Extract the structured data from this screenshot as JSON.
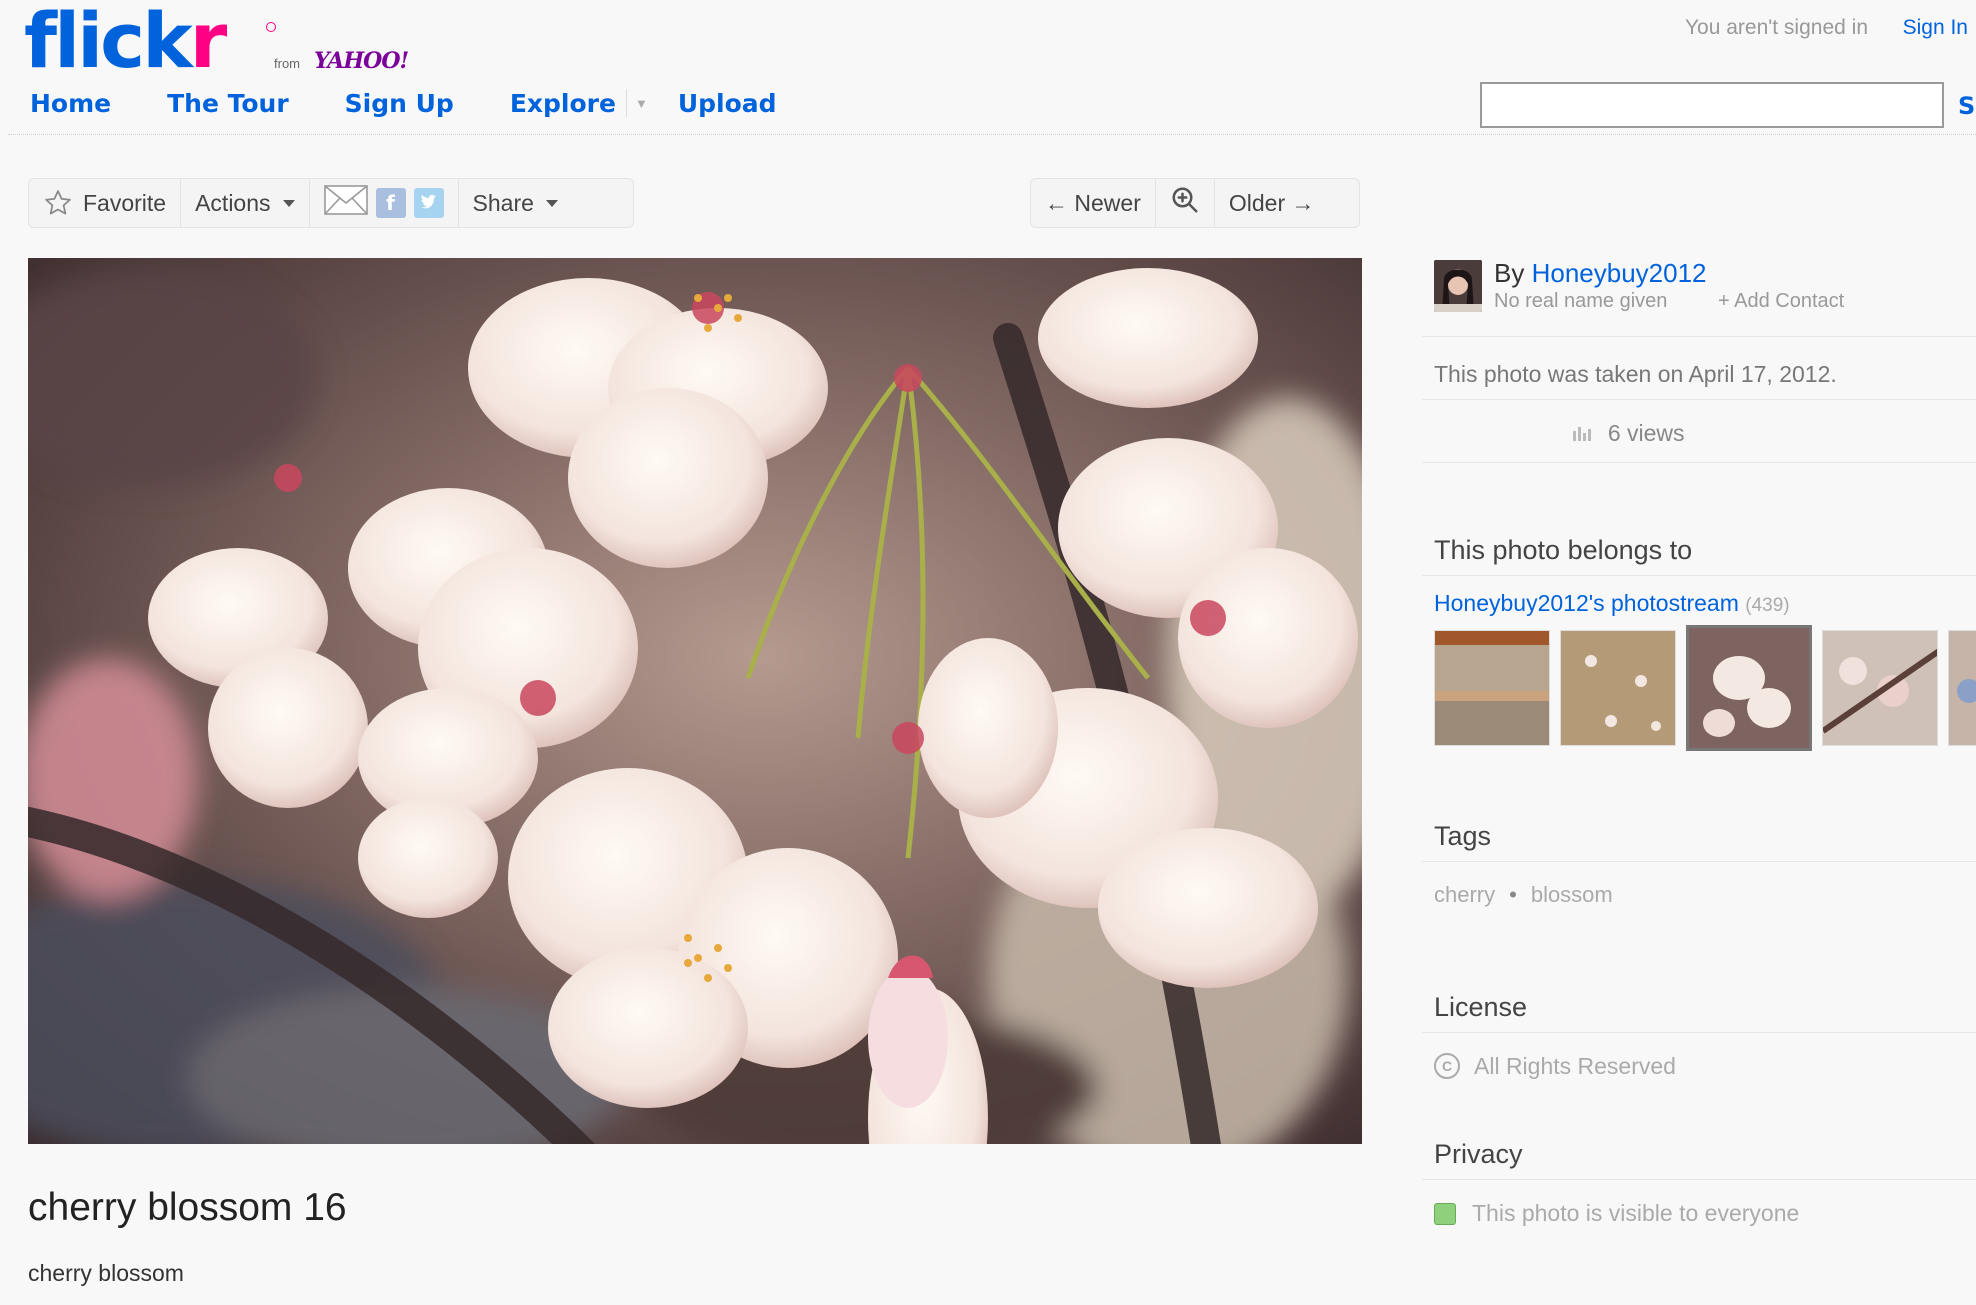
{
  "header": {
    "logo_flick": "flick",
    "logo_r": "r",
    "logo_from": "from",
    "logo_yahoo": "YAHOO!",
    "nav": {
      "home": "Home",
      "tour": "The Tour",
      "signup": "Sign Up",
      "explore": "Explore",
      "upload": "Upload"
    },
    "signin_note": "You aren't signed in",
    "signin_link": "Sign In",
    "search_value": "",
    "search_button_partial": "S"
  },
  "toolbar": {
    "favorite": "Favorite",
    "actions": "Actions",
    "share": "Share",
    "newer": "← Newer",
    "older": "Older →",
    "icons": [
      "star-icon",
      "mail-icon",
      "facebook-icon",
      "twitter-icon",
      "zoom-icon"
    ]
  },
  "photo": {
    "title": "cherry blossom 16",
    "description": "cherry blossom"
  },
  "sidebar": {
    "by_prefix": "By",
    "owner": "Honeybuy2012",
    "real_name": "No real name given",
    "add_contact": "+ Add Contact",
    "taken": "This photo was taken on April 17, 2012.",
    "views": "6 views",
    "belongs_heading": "This photo belongs to",
    "photostream_label": "Honeybuy2012's photostream",
    "photostream_count": "(439)",
    "tags_heading": "Tags",
    "tags": [
      "cherry",
      "blossom"
    ],
    "license_heading": "License",
    "license": "All Rights Reserved",
    "privacy_heading": "Privacy",
    "privacy": "This photo is visible to everyone"
  },
  "colors": {
    "link_blue": "#0063dc",
    "flickr_pink": "#ff0084",
    "yahoo_purple": "#7b0099",
    "privacy_green": "#8ed07c"
  }
}
